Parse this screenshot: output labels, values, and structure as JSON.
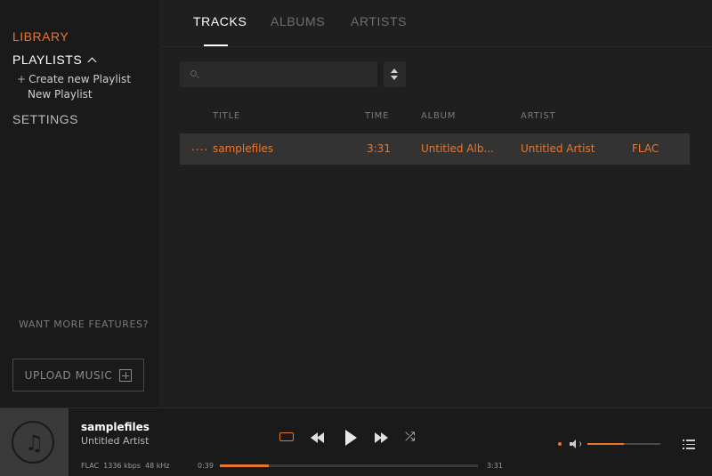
{
  "sidebar": {
    "library": "LIBRARY",
    "playlists": "PLAYLISTS",
    "create_playlist": "Create new Playlist",
    "playlist_items": [
      "New Playlist"
    ],
    "settings": "SETTINGS",
    "want_more": "WANT MORE FEATURES?",
    "upload": "UPLOAD MUSIC"
  },
  "tabs": [
    {
      "label": "TRACKS",
      "active": true
    },
    {
      "label": "ALBUMS",
      "active": false
    },
    {
      "label": "ARTISTS",
      "active": false
    }
  ],
  "search": {
    "placeholder": "",
    "value": ""
  },
  "table": {
    "headers": {
      "title": "TITLE",
      "time": "TIME",
      "album": "ALBUM",
      "artist": "ARTIST"
    },
    "rows": [
      {
        "indicator": "....",
        "title": "samplefiles",
        "time": "3:31",
        "album": "Untitled Alb...",
        "artist": "Untitled Artist",
        "format": "FLAC"
      }
    ]
  },
  "player": {
    "title": "samplefiles",
    "artist": "Untitled Artist",
    "format": "FLAC",
    "bitrate": "1336 kbps",
    "samplerate": "48 kHz",
    "current_time": "0:39",
    "total_time": "3:31",
    "progress": 0.19,
    "volume": 0.5
  },
  "colors": {
    "accent": "#e8772e",
    "background": "#1f1f1f",
    "sidebar": "#1a1a1a",
    "row_selected": "#333333"
  },
  "icons": [
    "chevron-up-icon",
    "plus-icon",
    "search-icon",
    "sort-icon",
    "music-note-icon",
    "repeat-icon",
    "previous-icon",
    "play-icon",
    "next-icon",
    "shuffle-icon",
    "volume-icon",
    "queue-icon"
  ]
}
